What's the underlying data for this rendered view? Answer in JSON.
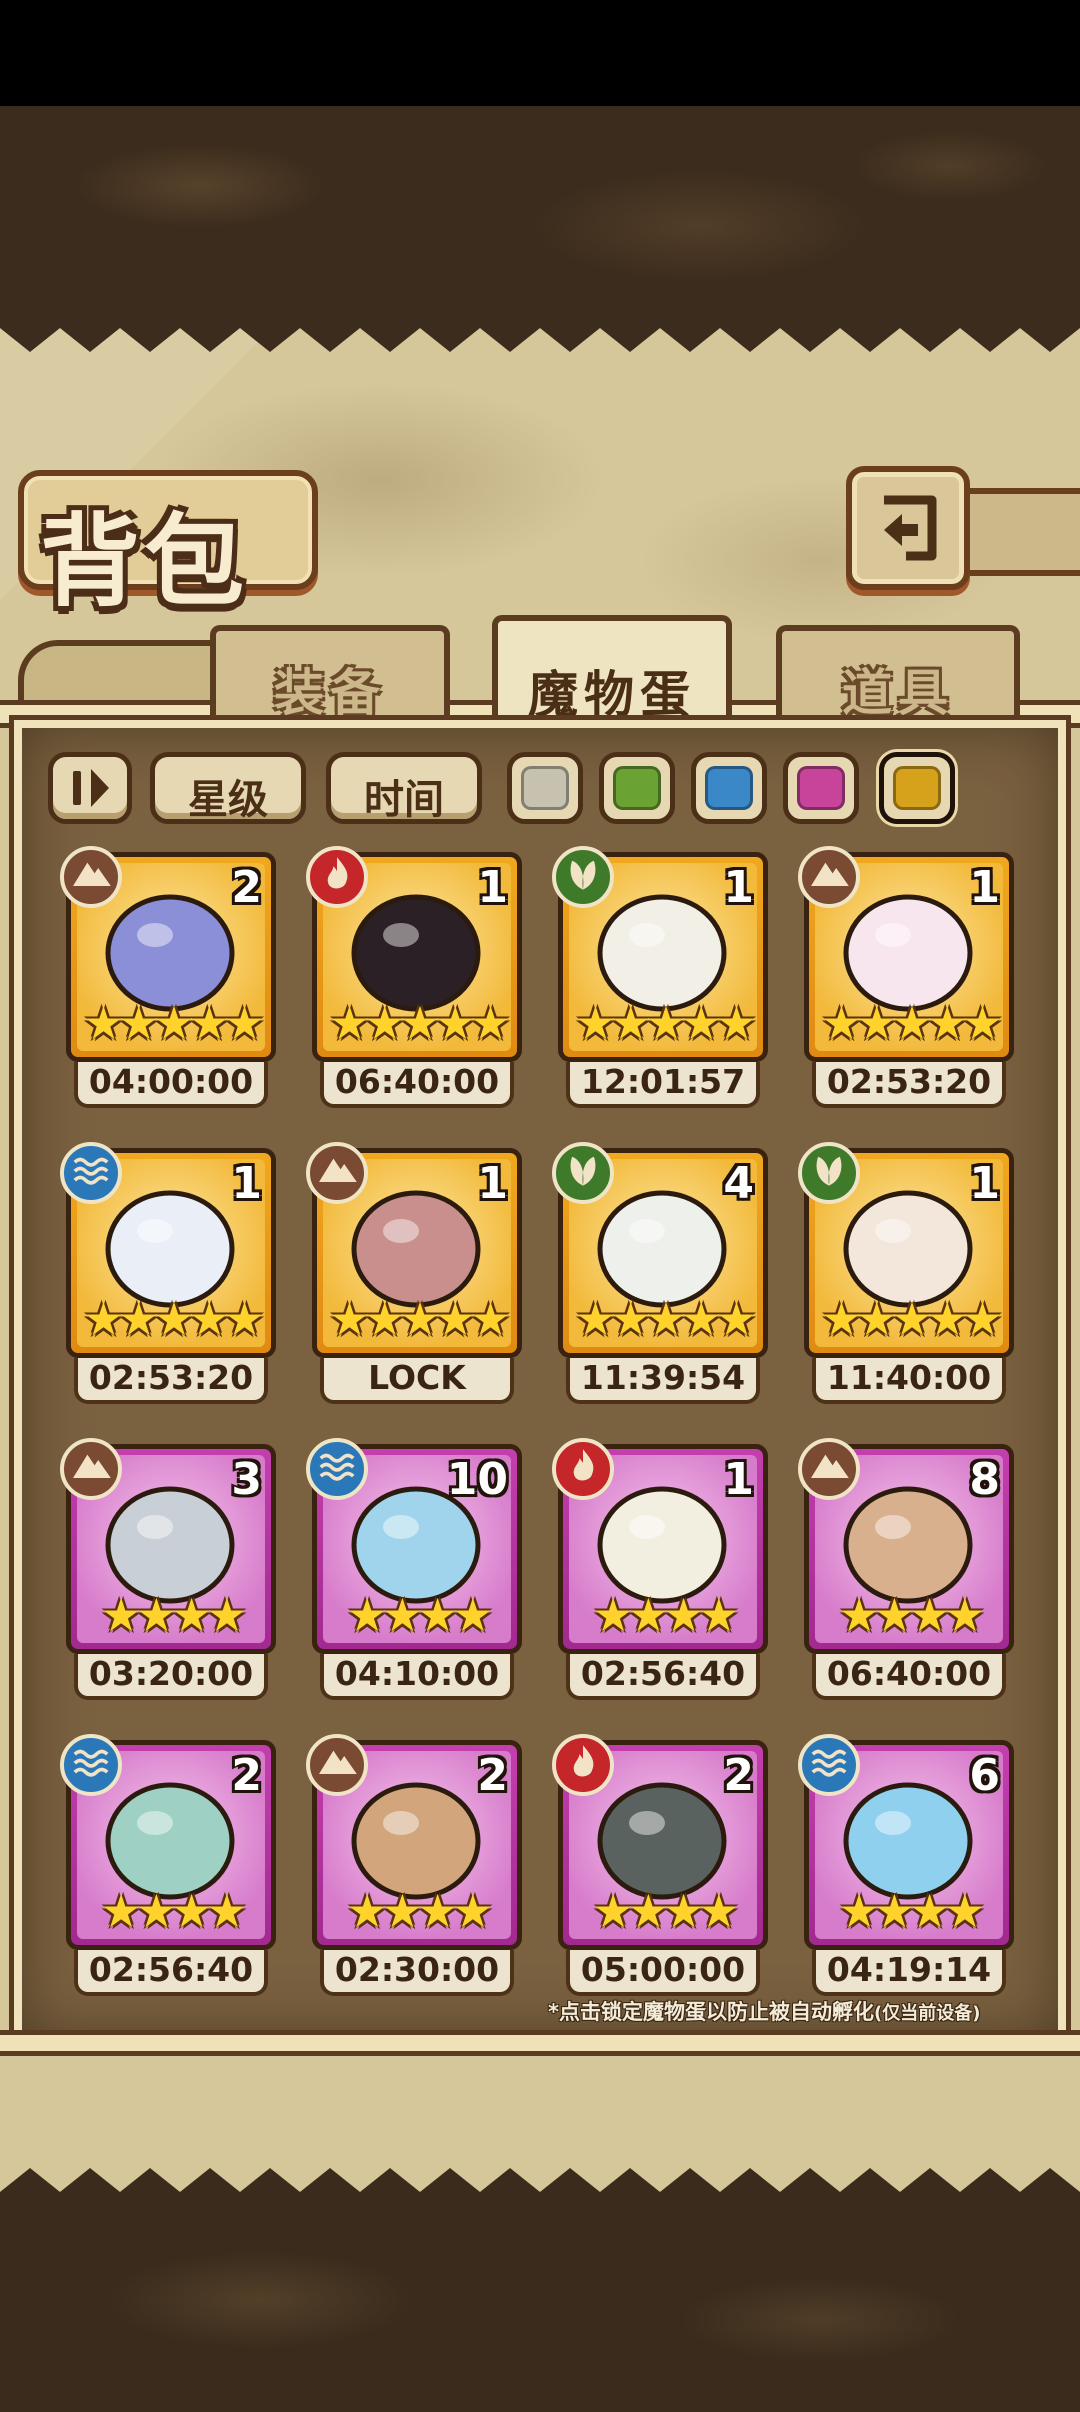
{
  "title": "背包",
  "tabs": [
    {
      "label": "装备",
      "active": false
    },
    {
      "label": "魔物蛋",
      "active": true
    },
    {
      "label": "道具",
      "active": false
    }
  ],
  "filters": {
    "sort_toggle_icon": "sort-toggle-icon",
    "star_label": "星级",
    "time_label": "时间",
    "color_swatches": [
      "#c7c2b0",
      "#6aa234",
      "#3a88c8",
      "#c8449a",
      "#d6a21c"
    ],
    "selected_swatch": 4
  },
  "elements": {
    "earth": "#7a4a33",
    "fire": "#c4262a",
    "leaf": "#3f7a2a",
    "water": "#2a78b8"
  },
  "eggs": [
    {
      "element": "earth",
      "count": "2",
      "stars": 5,
      "rarity": "gold",
      "timer": "04:00:00"
    },
    {
      "element": "fire",
      "count": "1",
      "stars": 5,
      "rarity": "gold",
      "timer": "06:40:00"
    },
    {
      "element": "leaf",
      "count": "1",
      "stars": 5,
      "rarity": "gold",
      "timer": "12:01:57"
    },
    {
      "element": "earth",
      "count": "1",
      "stars": 5,
      "rarity": "gold",
      "timer": "02:53:20"
    },
    {
      "element": "water",
      "count": "1",
      "stars": 5,
      "rarity": "gold",
      "timer": "02:53:20"
    },
    {
      "element": "earth",
      "count": "1",
      "stars": 5,
      "rarity": "gold",
      "timer": "LOCK"
    },
    {
      "element": "leaf",
      "count": "4",
      "stars": 5,
      "rarity": "gold",
      "timer": "11:39:54"
    },
    {
      "element": "leaf",
      "count": "1",
      "stars": 5,
      "rarity": "gold",
      "timer": "11:40:00"
    },
    {
      "element": "earth",
      "count": "3",
      "stars": 4,
      "rarity": "purple",
      "timer": "03:20:00"
    },
    {
      "element": "water",
      "count": "10",
      "stars": 4,
      "rarity": "purple",
      "timer": "04:10:00"
    },
    {
      "element": "fire",
      "count": "1",
      "stars": 4,
      "rarity": "purple",
      "timer": "02:56:40"
    },
    {
      "element": "earth",
      "count": "8",
      "stars": 4,
      "rarity": "purple",
      "timer": "06:40:00"
    },
    {
      "element": "water",
      "count": "2",
      "stars": 4,
      "rarity": "purple",
      "timer": "02:56:40"
    },
    {
      "element": "earth",
      "count": "2",
      "stars": 4,
      "rarity": "purple",
      "timer": "02:30:00"
    },
    {
      "element": "fire",
      "count": "2",
      "stars": 4,
      "rarity": "purple",
      "timer": "05:00:00"
    },
    {
      "element": "water",
      "count": "6",
      "stars": 4,
      "rarity": "purple",
      "timer": "04:19:14"
    }
  ],
  "note": "*点击锁定魔物蛋以防止被自动孵化",
  "note_suffix": "(仅当前设备)"
}
